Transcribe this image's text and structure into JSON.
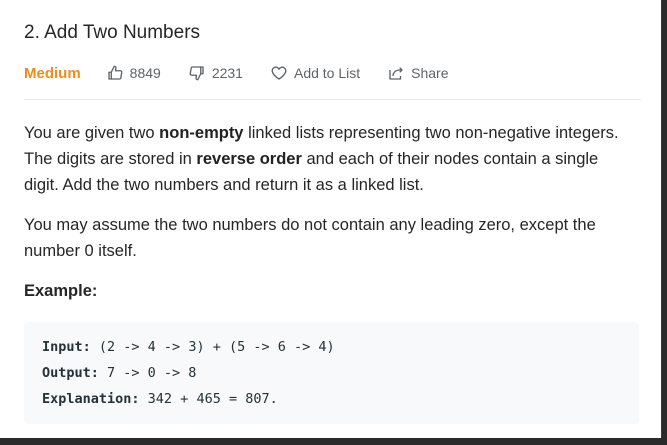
{
  "problem": {
    "title": "2. Add Two Numbers",
    "difficulty": "Medium",
    "likes": "8849",
    "dislikes": "2231",
    "add_to_list": "Add to List",
    "share": "Share"
  },
  "description": {
    "p1_a": "You are given two ",
    "p1_b": "non-empty",
    "p1_c": " linked lists representing two non-negative integers. The digits are stored in ",
    "p1_d": "reverse order",
    "p1_e": " and each of their nodes contain a single digit. Add the two numbers and return it as a linked list.",
    "p2": "You may assume the two numbers do not contain any leading zero, except the number 0 itself.",
    "example_heading": "Example:"
  },
  "example": {
    "input_label": "Input:",
    "input_value": " (2 -> 4 -> 3) + (5 -> 6 -> 4)",
    "output_label": "Output:",
    "output_value": " 7 -> 0 -> 8",
    "explanation_label": "Explanation:",
    "explanation_value": " 342 + 465 = 807."
  },
  "icons": {
    "like": "thumbs-up-icon",
    "dislike": "thumbs-down-icon",
    "favorite": "heart-icon",
    "share": "share-icon"
  },
  "colors": {
    "difficulty_medium": "#ef8c1a",
    "code_background": "#f7f9fa"
  }
}
